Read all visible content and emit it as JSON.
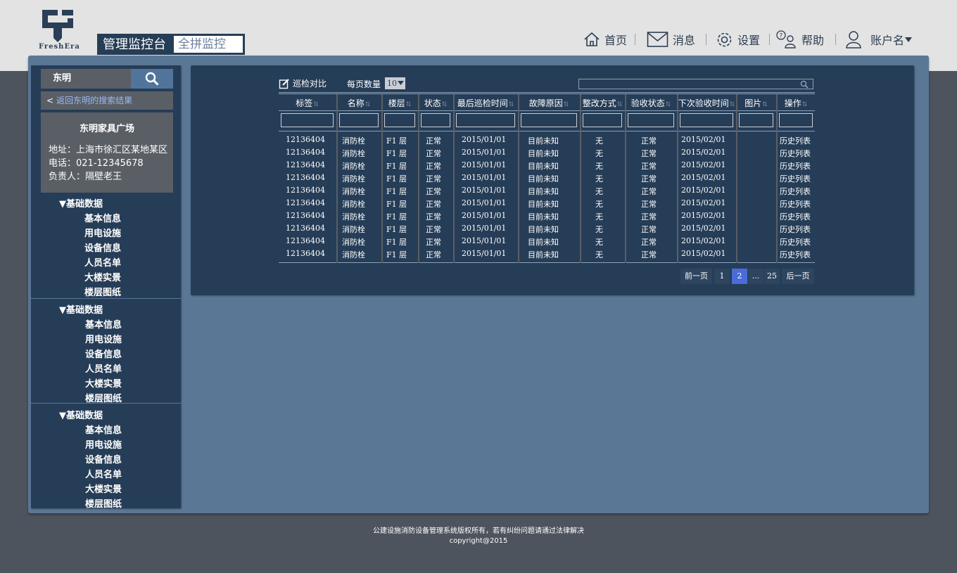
{
  "header": {
    "logo_text": "FreshEra",
    "title_main": "管理监控台",
    "title_sub": "全拼监控",
    "nav": {
      "home": "首页",
      "messages": "消息",
      "settings": "设置",
      "help": "帮助",
      "account": "账户名"
    }
  },
  "sidebar": {
    "search_value": "东明",
    "back_prefix": "<",
    "back_link": "返回东明的搜索结果",
    "info": {
      "name": "东明家具广场",
      "address": "地址：上海市徐汇区某地某区",
      "phone": "电话：021-12345678",
      "owner": "负责人：隔壁老王"
    },
    "groups": [
      {
        "label": "▼基础数据",
        "items": [
          "基本信息",
          "用电设施",
          "设备信息",
          "人员名单",
          "大楼实景",
          "楼层图纸"
        ]
      },
      {
        "label": "▼基础数据",
        "items": [
          "基本信息",
          "用电设施",
          "设备信息",
          "人员名单",
          "大楼实景",
          "楼层图纸"
        ]
      },
      {
        "label": "▼基础数据",
        "items": [
          "基本信息",
          "用电设施",
          "设备信息",
          "人员名单",
          "大楼实景",
          "楼层图纸"
        ]
      }
    ]
  },
  "toolbar": {
    "compare_label": "巡检对比",
    "per_page_label": "每页数量",
    "per_page_value": "10"
  },
  "table": {
    "headers": [
      "标签",
      "名称",
      "楼层",
      "状态",
      "最后巡检时间",
      "故障原因",
      "整改方式",
      "验收状态",
      "下次验收时间",
      "图片",
      "操作"
    ],
    "rows": [
      [
        "12136404",
        "消防栓",
        "F1 层",
        "正常",
        "2015/01/01",
        "目前未知",
        "无",
        "正常",
        "2015/02/01",
        "",
        "历史列表"
      ],
      [
        "12136404",
        "消防栓",
        "F1 层",
        "正常",
        "2015/01/01",
        "目前未知",
        "无",
        "正常",
        "2015/02/01",
        "",
        "历史列表"
      ],
      [
        "12136404",
        "消防栓",
        "F1 层",
        "正常",
        "2015/01/01",
        "目前未知",
        "无",
        "正常",
        "2015/02/01",
        "",
        "历史列表"
      ],
      [
        "12136404",
        "消防栓",
        "F1 层",
        "正常",
        "2015/01/01",
        "目前未知",
        "无",
        "正常",
        "2015/02/01",
        "",
        "历史列表"
      ],
      [
        "12136404",
        "消防栓",
        "F1 层",
        "正常",
        "2015/01/01",
        "目前未知",
        "无",
        "正常",
        "2015/02/01",
        "",
        "历史列表"
      ],
      [
        "12136404",
        "消防栓",
        "F1 层",
        "正常",
        "2015/01/01",
        "目前未知",
        "无",
        "正常",
        "2015/02/01",
        "",
        "历史列表"
      ],
      [
        "12136404",
        "消防栓",
        "F1 层",
        "正常",
        "2015/01/01",
        "目前未知",
        "无",
        "正常",
        "2015/02/01",
        "",
        "历史列表"
      ],
      [
        "12136404",
        "消防栓",
        "F1 层",
        "正常",
        "2015/01/01",
        "目前未知",
        "无",
        "正常",
        "2015/02/01",
        "",
        "历史列表"
      ],
      [
        "12136404",
        "消防栓",
        "F1 层",
        "正常",
        "2015/01/01",
        "目前未知",
        "无",
        "正常",
        "2015/02/01",
        "",
        "历史列表"
      ],
      [
        "12136404",
        "消防栓",
        "F1 层",
        "正常",
        "2015/01/01",
        "目前未知",
        "无",
        "正常",
        "2015/02/01",
        "",
        "历史列表"
      ]
    ]
  },
  "pagination": {
    "prev": "前一页",
    "pages": [
      "1",
      "2",
      "...",
      "25"
    ],
    "current": "2",
    "next": "后一页"
  },
  "footer": {
    "line1": "公建设施消防设备管理系统版权所有，若有纠纷问题请通过法律解决",
    "line2": "copyright@2015"
  },
  "colors": {
    "navy": "#263d57",
    "frame": "#5a7796",
    "active_page": "#4a6cd8",
    "link": "#9ab8f0"
  }
}
